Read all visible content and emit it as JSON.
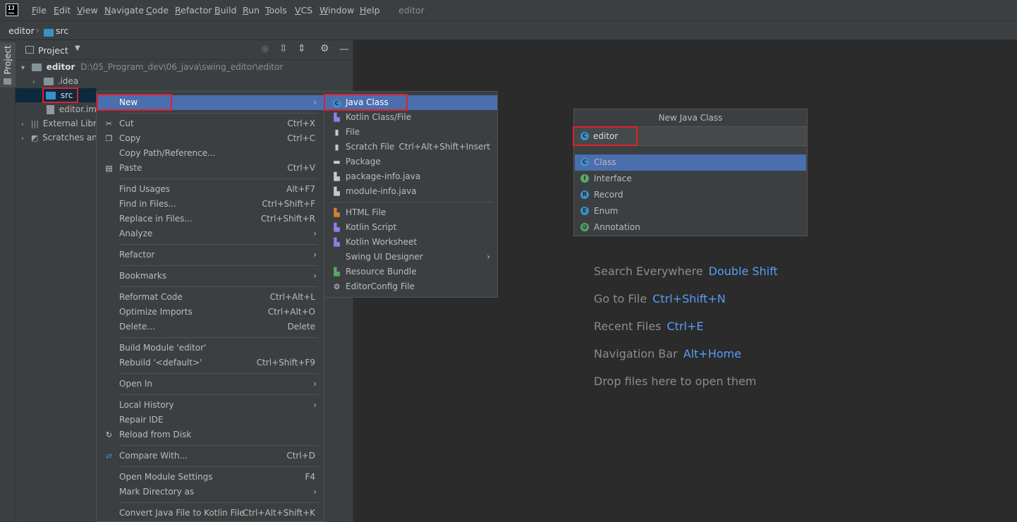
{
  "menubar": {
    "items": [
      {
        "label": "File",
        "mnemonic": "F",
        "rest": "ile"
      },
      {
        "label": "Edit",
        "mnemonic": "E",
        "rest": "dit"
      },
      {
        "label": "View",
        "mnemonic": "V",
        "rest": "iew"
      },
      {
        "label": "Navigate",
        "mnemonic": "N",
        "rest": "avigate"
      },
      {
        "label": "Code",
        "mnemonic": "C",
        "rest": "ode"
      },
      {
        "label": "Refactor",
        "mnemonic": "R",
        "rest": "efactor"
      },
      {
        "label": "Build",
        "mnemonic": "B",
        "rest": "uild"
      },
      {
        "label": "Run",
        "mnemonic": "R",
        "rest": "un"
      },
      {
        "label": "Tools",
        "mnemonic": "T",
        "rest": "ools"
      },
      {
        "label": "VCS",
        "mnemonic": "V",
        "rest": "CS"
      },
      {
        "label": "Window",
        "mnemonic": "W",
        "rest": "indow"
      },
      {
        "label": "Help",
        "mnemonic": "H",
        "rest": "elp"
      }
    ],
    "window_title": "editor",
    "logo_text": "IJ"
  },
  "navbar": {
    "project": "editor",
    "folder": "src"
  },
  "stripe": {
    "tab_label": "Project"
  },
  "project_panel": {
    "title": "Project",
    "tree": {
      "root_name": "editor",
      "root_path": "D:\\05_Program_dev\\06_java\\swing_editor\\editor",
      "idea": ".idea",
      "src": "src",
      "iml": "editor.iml",
      "external": "External Libra",
      "scratches": "Scratches and"
    }
  },
  "context_menu": {
    "items": [
      {
        "label": "New",
        "submenu": true
      },
      {
        "label": "Cut",
        "shortcut": "Ctrl+X"
      },
      {
        "label": "Copy",
        "shortcut": "Ctrl+C"
      },
      {
        "label": "Copy Path/Reference..."
      },
      {
        "label": "Paste",
        "shortcut": "Ctrl+V"
      },
      {
        "label": "Find Usages",
        "shortcut": "Alt+F7"
      },
      {
        "label": "Find in Files...",
        "shortcut": "Ctrl+Shift+F"
      },
      {
        "label": "Replace in Files...",
        "shortcut": "Ctrl+Shift+R"
      },
      {
        "label": "Analyze",
        "submenu": true
      },
      {
        "label": "Refactor",
        "submenu": true
      },
      {
        "label": "Bookmarks",
        "submenu": true
      },
      {
        "label": "Reformat Code",
        "shortcut": "Ctrl+Alt+L"
      },
      {
        "label": "Optimize Imports",
        "shortcut": "Ctrl+Alt+O"
      },
      {
        "label": "Delete...",
        "shortcut": "Delete"
      },
      {
        "label": "Build Module 'editor'"
      },
      {
        "label": "Rebuild '<default>'",
        "shortcut": "Ctrl+Shift+F9"
      },
      {
        "label": "Open In",
        "submenu": true
      },
      {
        "label": "Local History",
        "submenu": true
      },
      {
        "label": "Repair IDE"
      },
      {
        "label": "Reload from Disk"
      },
      {
        "label": "Compare With...",
        "shortcut": "Ctrl+D"
      },
      {
        "label": "Open Module Settings",
        "shortcut": "F4"
      },
      {
        "label": "Mark Directory as",
        "submenu": true
      },
      {
        "label": "Convert Java File to Kotlin File",
        "shortcut": "Ctrl+Alt+Shift+K"
      }
    ]
  },
  "new_submenu": {
    "items": [
      {
        "label": "Java Class"
      },
      {
        "label": "Kotlin Class/File"
      },
      {
        "label": "File"
      },
      {
        "label": "Scratch File",
        "shortcut": "Ctrl+Alt+Shift+Insert"
      },
      {
        "label": "Package"
      },
      {
        "label": "package-info.java"
      },
      {
        "label": "module-info.java"
      },
      {
        "label": "HTML File"
      },
      {
        "label": "Kotlin Script"
      },
      {
        "label": "Kotlin Worksheet"
      },
      {
        "label": "Swing UI Designer",
        "submenu": true
      },
      {
        "label": "Resource Bundle"
      },
      {
        "label": "EditorConfig File"
      }
    ]
  },
  "dialog": {
    "title": "New Java Class",
    "input_value": "editor",
    "options": [
      "Class",
      "Interface",
      "Record",
      "Enum",
      "Annotation"
    ],
    "option_letters": [
      "C",
      "I",
      "R",
      "E",
      "@"
    ]
  },
  "editor_hints": [
    {
      "label": "Search Everywhere",
      "key": "Double Shift"
    },
    {
      "label": "Go to File",
      "key": "Ctrl+Shift+N"
    },
    {
      "label": "Recent Files",
      "key": "Ctrl+E"
    },
    {
      "label": "Navigation Bar",
      "key": "Alt+Home"
    },
    {
      "label": "Drop files here to open them",
      "key": ""
    }
  ],
  "colors": {
    "selection": "#4b6eaf",
    "highlight_box": "#e0202a",
    "link": "#589df6"
  }
}
